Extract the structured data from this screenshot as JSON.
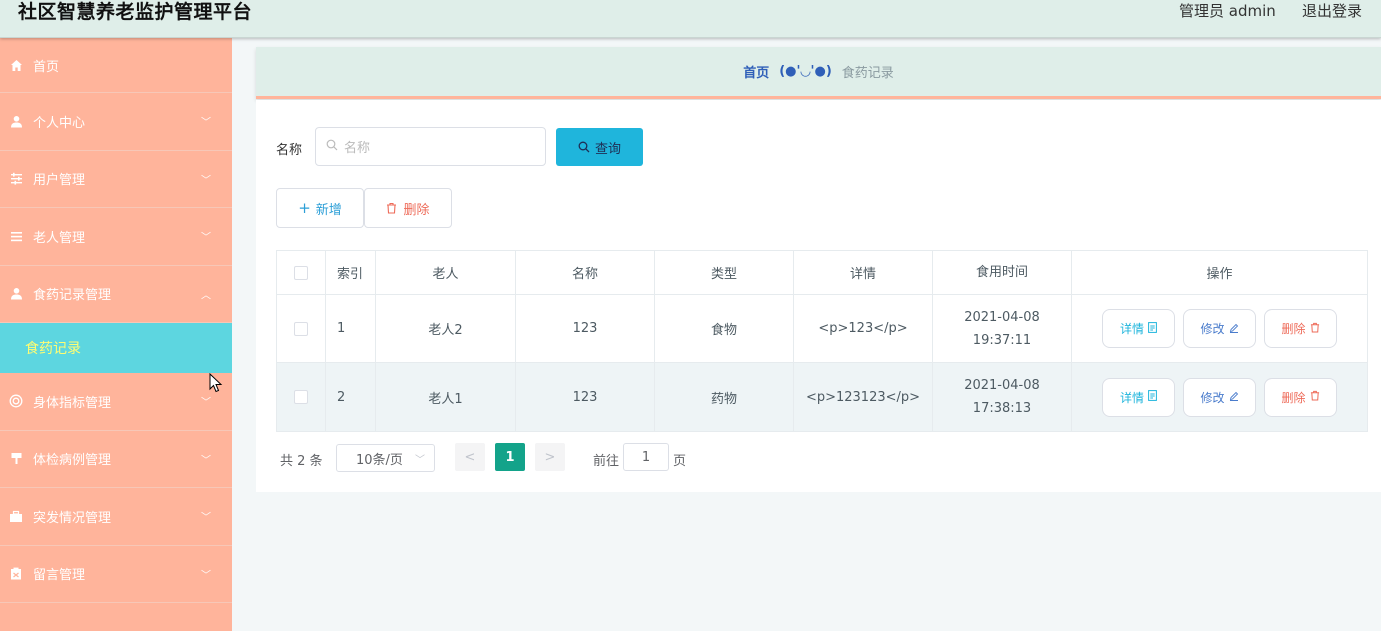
{
  "header": {
    "title": "社区智慧养老监护管理平台",
    "user": "管理员 admin",
    "logout": "退出登录"
  },
  "sidebar": {
    "items": [
      {
        "label": "首页",
        "icon": "home-icon"
      },
      {
        "label": "个人中心",
        "icon": "user-icon"
      },
      {
        "label": "用户管理",
        "icon": "sliders-icon"
      },
      {
        "label": "老人管理",
        "icon": "list-icon"
      },
      {
        "label": "食药记录管理",
        "icon": "user-icon"
      },
      {
        "label": "身体指标管理",
        "icon": "target-icon"
      },
      {
        "label": "体检病例管理",
        "icon": "brush-icon"
      },
      {
        "label": "突发情况管理",
        "icon": "briefcase-icon"
      },
      {
        "label": "留言管理",
        "icon": "clipboard-icon"
      }
    ],
    "submenu": {
      "label": "食药记录"
    }
  },
  "breadcrumb": {
    "home": "首页",
    "separator": "(●'◡'●)",
    "current": "食药记录"
  },
  "search": {
    "label": "名称",
    "placeholder": "名称",
    "button": "查询"
  },
  "actions": {
    "add": "新增",
    "delete": "删除"
  },
  "table": {
    "headers": [
      "索引",
      "老人",
      "名称",
      "类型",
      "详情",
      "食用时间",
      "操作"
    ],
    "rows": [
      {
        "index": "1",
        "elder": "老人2",
        "name": "123",
        "type": "食物",
        "detail": "<p>123</p>",
        "time": "2021-04-08 19:37:11"
      },
      {
        "index": "2",
        "elder": "老人1",
        "name": "123",
        "type": "药物",
        "detail": "<p>123123</p>",
        "time": "2021-04-08 17:38:13"
      }
    ],
    "row_actions": {
      "detail": "详情",
      "edit": "修改",
      "delete": "删除"
    }
  },
  "pagination": {
    "total": "共 2 条",
    "page_size": "10条/页",
    "current_page": "1",
    "goto_prefix": "前往",
    "goto_value": "1",
    "goto_suffix": "页"
  },
  "colors": {
    "sidebar": "#ffb49b",
    "active_submenu": "#5dd6e0",
    "header": "#dfeee9",
    "primary": "#1fb5dc",
    "danger": "#ee6b59",
    "pager_active": "#13a38a"
  }
}
